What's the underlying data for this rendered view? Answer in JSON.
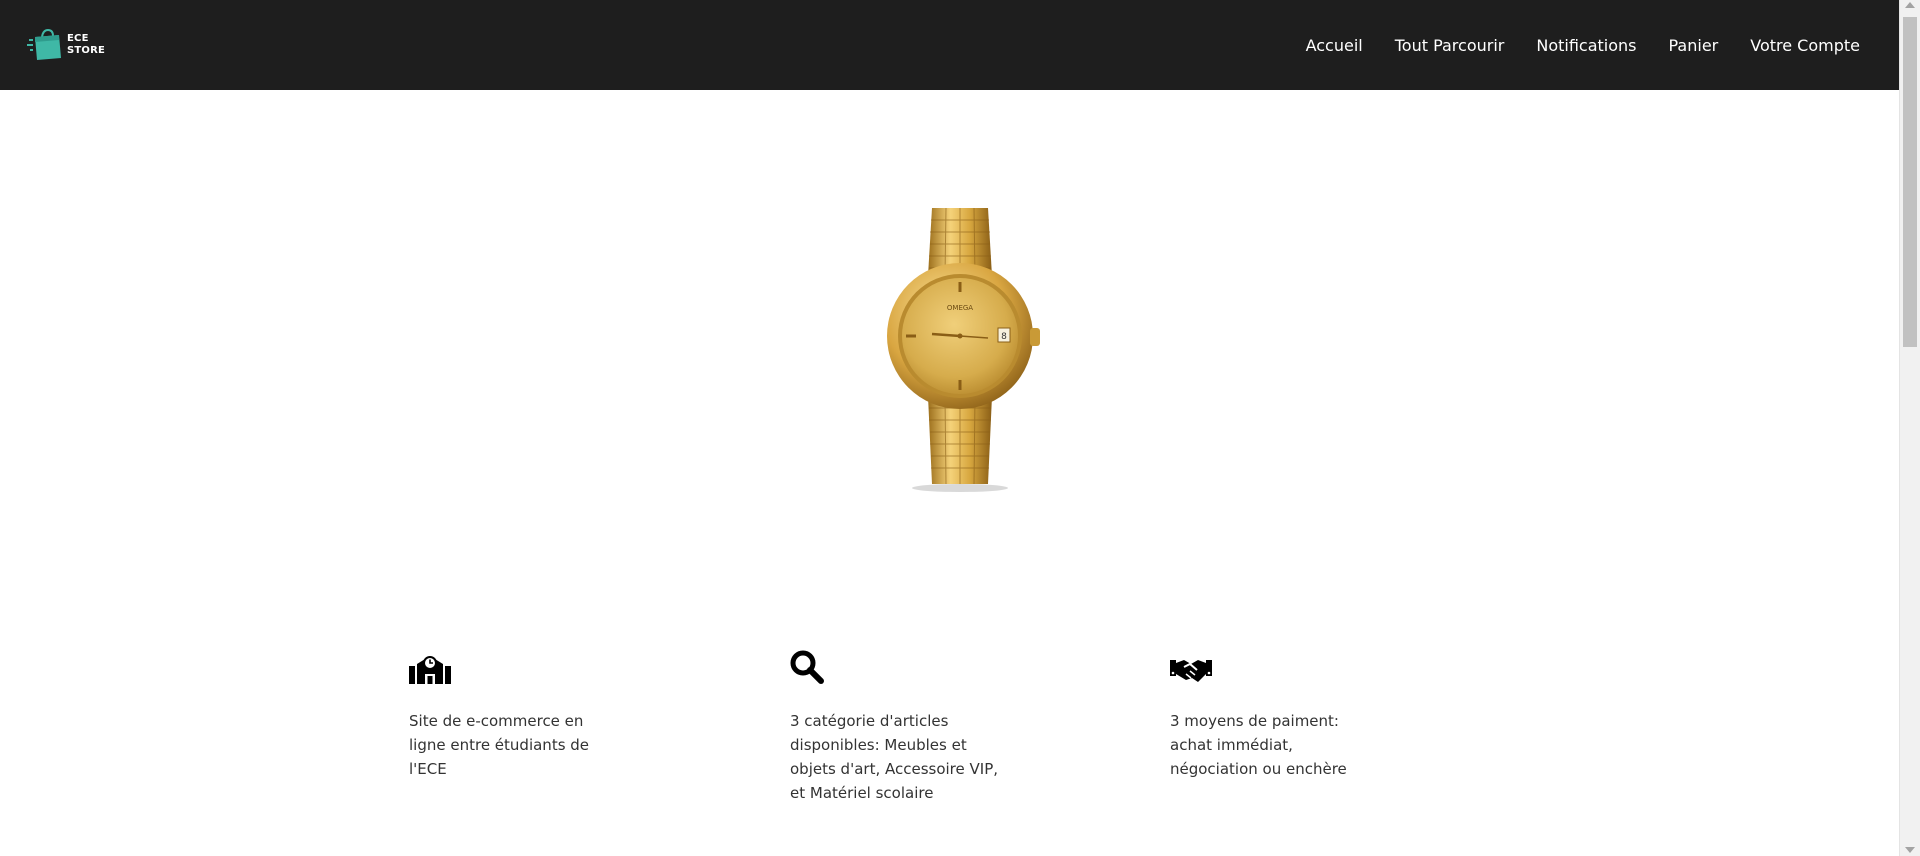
{
  "header": {
    "logo_text_line1": "ECE",
    "logo_text_line2": "STORE",
    "nav": [
      {
        "label": "Accueil"
      },
      {
        "label": "Tout Parcourir"
      },
      {
        "label": "Notifications"
      },
      {
        "label": "Panier"
      },
      {
        "label": "Votre Compte"
      }
    ]
  },
  "hero": {
    "icon": "gold-watch-image"
  },
  "features": [
    {
      "icon": "school-icon",
      "text": "Site de e-commerce en ligne entre étudiants de l'ECE"
    },
    {
      "icon": "search-icon",
      "text": "3 catégorie d'articles disponibles: Meubles et objets d'art, Accessoire VIP, et Matériel scolaire"
    },
    {
      "icon": "handshake-icon",
      "text": "3 moyens de paiment: achat immédiat, négociation ou enchère"
    }
  ],
  "colors": {
    "navbar": "#1e1e1e",
    "logo_accent": "#3fb8a6",
    "gold": "#d4a93c"
  }
}
